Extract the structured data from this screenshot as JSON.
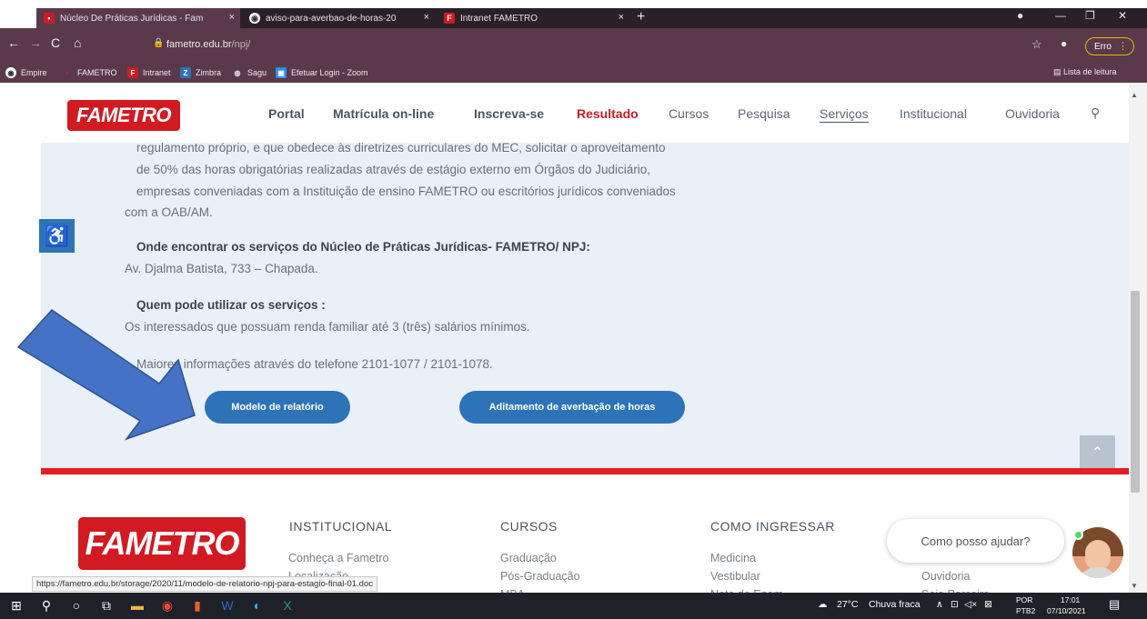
{
  "browser": {
    "tabs": [
      {
        "title": "Núcleo De Práticas Jurídicas - Fam",
        "close": "×"
      },
      {
        "title": "aviso-para-averbao-de-horas-20",
        "close": "×"
      },
      {
        "title": "Intranet FAMETRO",
        "close": "×"
      }
    ],
    "new_tab": "+",
    "url_host": "fametro.edu.br",
    "url_path": "/npj/",
    "profile_status": "Erro",
    "bookmarks": [
      "Empire",
      "FAMETRO",
      "Intranet",
      "Zimbra",
      "Sagu",
      "Efetuar Login - Zoom"
    ],
    "reading_list": "Lista de leitura",
    "window_controls": {
      "minimize": "—",
      "maximize": "❐",
      "close": "✕"
    }
  },
  "site": {
    "logo": "FAMETRO",
    "nav": [
      "Portal",
      "Matrícula on-line",
      "Inscreva-se",
      "Resultado",
      "Cursos",
      "Pesquisa",
      "Serviços",
      "Institucional",
      "Ouvidoria"
    ]
  },
  "content": {
    "para1_l1": "regulamento próprio, e que obedece às diretrizes curriculares do MEC, solicitar o aproveitamento",
    "para1_l2": "de 50% das horas obrigatórias realizadas através de estágio externo em Órgãos do Judiciário,",
    "para1_l3": "empresas conveniadas com a Instituição de ensino FAMETRO ou escritórios jurídicos conveniados",
    "para1_l4": "com a OAB/AM.",
    "where_title": "Onde encontrar os serviços do Núcleo de Práticas Jurídicas- FAMETRO/ NPJ:",
    "where_text": "Av. Djalma Batista, 733 – Chapada.",
    "who_title": "Quem pode utilizar os serviços :",
    "who_text": "Os interessados que possuam renda familiar até 3 (três) salários mínimos.",
    "more_info": "Maiores informações através do telefone  2101-1077 / 2101-1078.",
    "btn_report": "Modelo de relatório",
    "btn_addendum": "Aditamento de averbação de horas"
  },
  "footer": {
    "logo": "FAMETRO",
    "col1_title": "INSTITUCIONAL",
    "col1_items": [
      "Conheça a Fametro",
      "Localização"
    ],
    "col2_title": "CURSOS",
    "col2_items": [
      "Graduação",
      "Pós-Graduação",
      "MBA"
    ],
    "col3_title": "COMO INGRESSAR",
    "col3_items": [
      "Medicina",
      "Vestibular",
      "Nota do Enem"
    ],
    "col4_items": [
      "Ouvidoria",
      "Seja Parceiro"
    ],
    "chat_prompt": "Como posso ajudar?"
  },
  "status_url": "https://fametro.edu.br/storage/2020/11/modelo-de-relatorio-npj-para-estagio-final-01.doc",
  "taskbar": {
    "temperature": "27°C",
    "weather": "Chuva fraca",
    "lang1": "POR",
    "lang2": "PTB2",
    "time": "17:01",
    "date": "07/10/2021"
  },
  "colors": {
    "brand_red": "#d11a22",
    "button_blue": "#2d73b8",
    "content_bg": "#e9f0f8",
    "browser_chrome": "#5a3a4a"
  }
}
